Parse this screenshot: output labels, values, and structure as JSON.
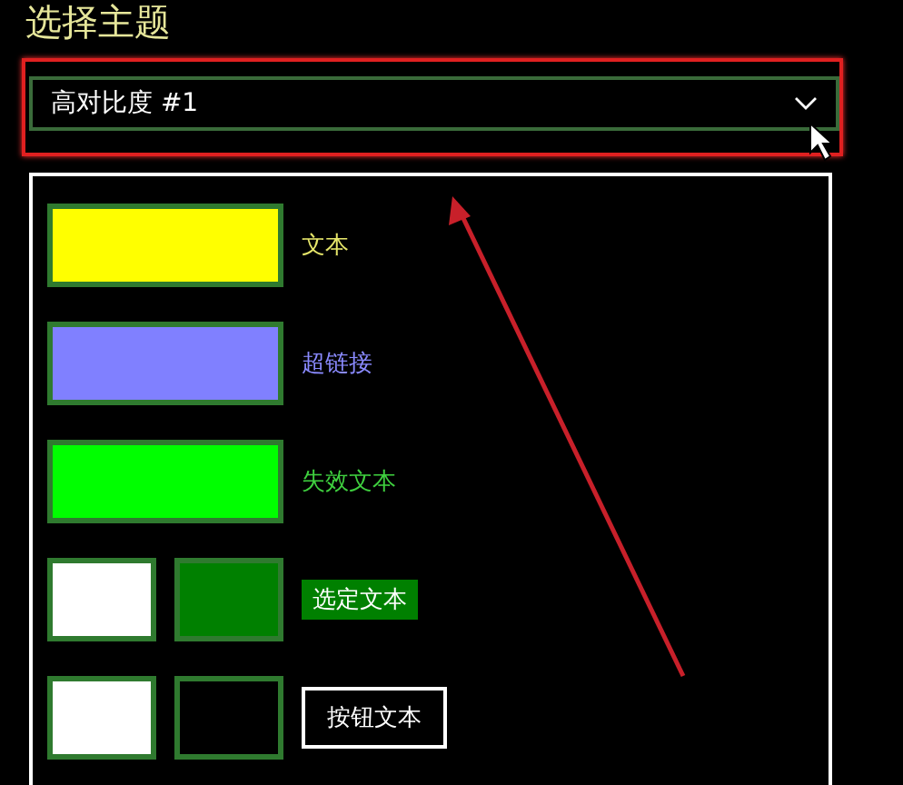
{
  "title": "选择主题",
  "theme_select": {
    "value": "高对比度 #1"
  },
  "preview_rows": [
    {
      "kind": "single",
      "swatches": [
        {
          "color": "#ffff00"
        }
      ],
      "label": {
        "text": "文本",
        "color": "#e6e66a"
      }
    },
    {
      "kind": "single",
      "swatches": [
        {
          "color": "#8080ff"
        }
      ],
      "label": {
        "text": "超链接",
        "color": "#8a8aff"
      }
    },
    {
      "kind": "single",
      "swatches": [
        {
          "color": "#00ff00"
        }
      ],
      "label": {
        "text": "失效文本",
        "color": "#3fd03f"
      }
    },
    {
      "kind": "highlight",
      "swatches": [
        {
          "color": "#ffffff"
        },
        {
          "color": "#008000"
        }
      ],
      "label": {
        "text": "选定文本",
        "color": "#008000"
      }
    },
    {
      "kind": "button",
      "swatches": [
        {
          "color": "#ffffff"
        },
        {
          "color": "#000000"
        }
      ],
      "label": {
        "text": "按钮文本",
        "color": "#ffffff"
      }
    }
  ]
}
